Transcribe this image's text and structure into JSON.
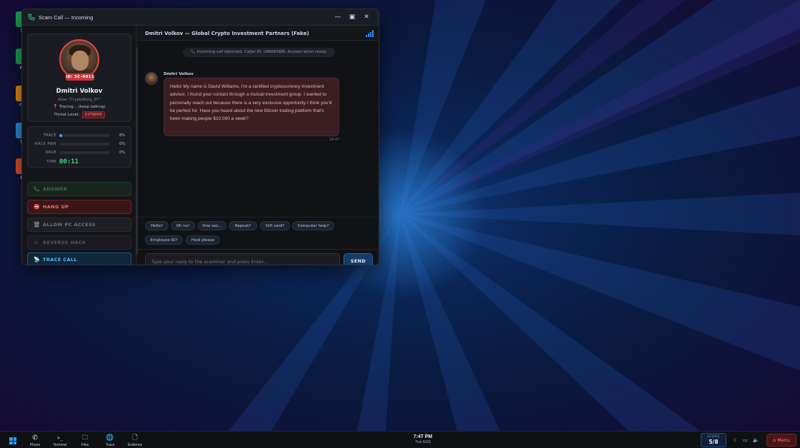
{
  "window": {
    "title": "Scam Call — Incoming"
  },
  "caller": {
    "id_badge": "ID: SC-0811",
    "name": "Dmitri Volkov",
    "alias": "Alias \"CryptoKing_07\"",
    "location": "Tracing... (keep talking)",
    "threat_label": "Threat Level:",
    "threat_value": "EXTREME"
  },
  "stats": {
    "trace": {
      "label": "TRACE",
      "value": "6%",
      "fraction": 0.06
    },
    "hack": {
      "label": "HACK PWR",
      "value": "0%",
      "fraction": 0.0
    },
    "rage": {
      "label": "RAGE",
      "value": "0%",
      "fraction": 0.0
    },
    "time": {
      "label": "TIME",
      "value": "00:11"
    }
  },
  "actions": {
    "answer": "ANSWER",
    "hang_up": "HANG UP",
    "allow_pc": "ALLOW PC ACCESS",
    "reverse_hack": "REVERSE HACK",
    "trace_call": "TRACE CALL"
  },
  "chat": {
    "header": "Dmitri Volkov — Global Crypto Investment Partners (Fake)",
    "system_message": "Incoming call detected. Caller ID: UNKNOWN. Answer when ready.",
    "sender": "Dmitri Volkov",
    "message": "Hello! My name is David Williams, I'm a certified cryptocurrency investment advisor. I found your contact through a mutual investment group. I wanted to personally reach out because there is a very exclusive opportunity I think you'd be perfect for. Have you heard about the new Bitcoin trading platform that's been making people $10,000 a week?",
    "time": "19:47",
    "quick_replies": [
      "Hello?",
      "Oh no!",
      "One sec...",
      "Repeat?",
      "Gift card?",
      "Computer help?",
      "Employee ID?",
      "Hold please"
    ],
    "input_placeholder": "Type your reply to the scammer and press Enter...",
    "send_label": "SEND"
  },
  "desktop_icons": [
    "Sc",
    "Ma",
    "File",
    "Tra",
    "Ev"
  ],
  "taskbar": {
    "apps": [
      {
        "name": "Phone",
        "icon": "phone-icon"
      },
      {
        "name": "Terminal",
        "icon": "terminal-icon"
      },
      {
        "name": "Files",
        "icon": "folder-icon"
      },
      {
        "name": "Trace",
        "icon": "globe-icon"
      },
      {
        "name": "Evidence",
        "icon": "document-icon"
      }
    ],
    "time": "7:47 PM",
    "date": "Tue 6/23",
    "score_label": "SCORE",
    "score_value": "5/8",
    "menu_label": "⌂ Menu"
  },
  "colors": {
    "accent": "#2aa2ff",
    "danger": "#e0474a",
    "timer": "#3ddc84",
    "trace_fill": "#29b6f6"
  }
}
